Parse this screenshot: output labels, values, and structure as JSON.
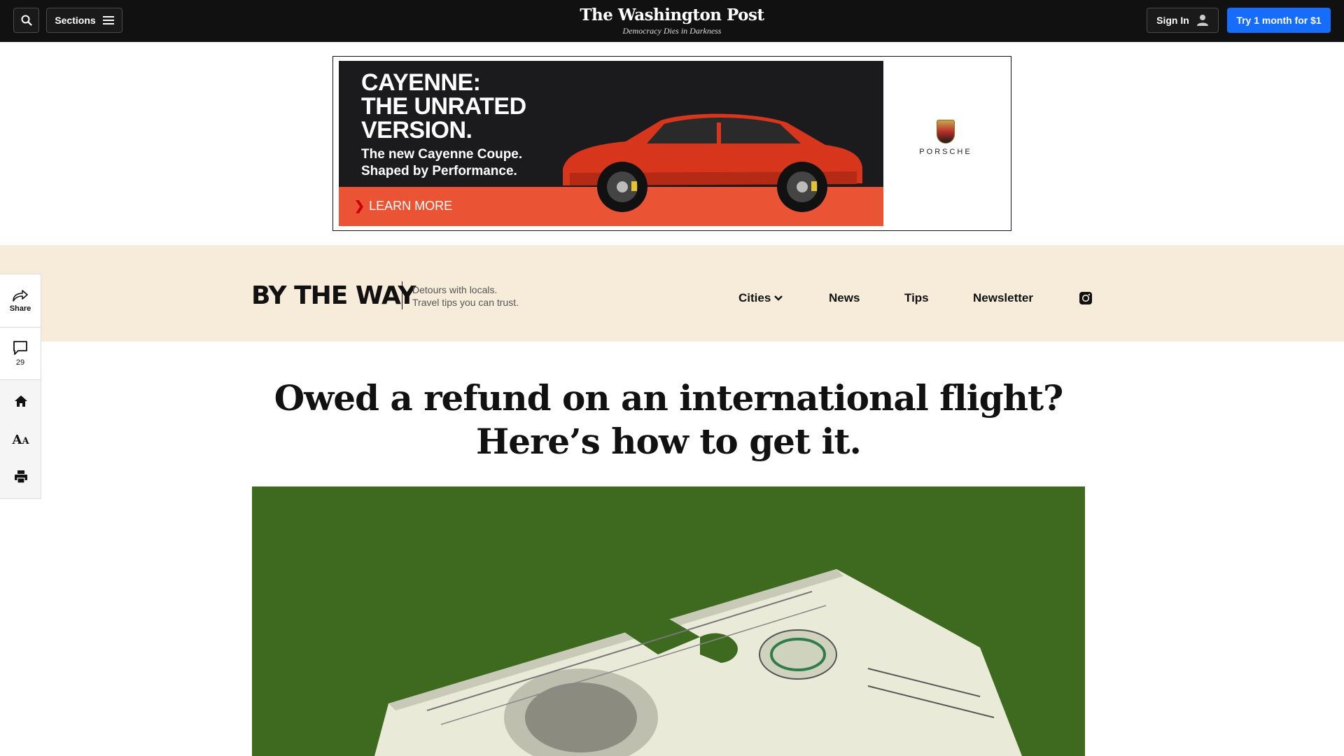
{
  "topnav": {
    "sections_label": "Sections",
    "masthead_title": "The Washington Post",
    "masthead_tagline": "Democracy Dies in Darkness",
    "signin_label": "Sign In",
    "subscribe_label": "Try 1 month for $1"
  },
  "ad": {
    "headline_lines": [
      "CAYENNE:",
      "THE UNRATED",
      "VERSION."
    ],
    "subline_lines": [
      "The new Cayenne Coupe.",
      "Shaped by Performance."
    ],
    "cta": "LEARN MORE",
    "brand": "PORSCHE",
    "colors": {
      "cta_bar": "#ea5434",
      "car": "#d8361c"
    }
  },
  "section_header": {
    "logo": "BY THE WAY",
    "desc_line1": "Detours with locals.",
    "desc_line2": "Travel tips you can trust.",
    "nav": [
      "Cities",
      "News",
      "Tips",
      "Newsletter"
    ],
    "instagram_icon": "instagram-icon",
    "background": "#f7ecda"
  },
  "rail": {
    "share_label": "Share",
    "comments_count": "29",
    "text_size_icon_label": "AA"
  },
  "article": {
    "headline": "Owed a refund on an international flight? Here’s how to get it.",
    "hero_background": "#3d6a1f"
  }
}
